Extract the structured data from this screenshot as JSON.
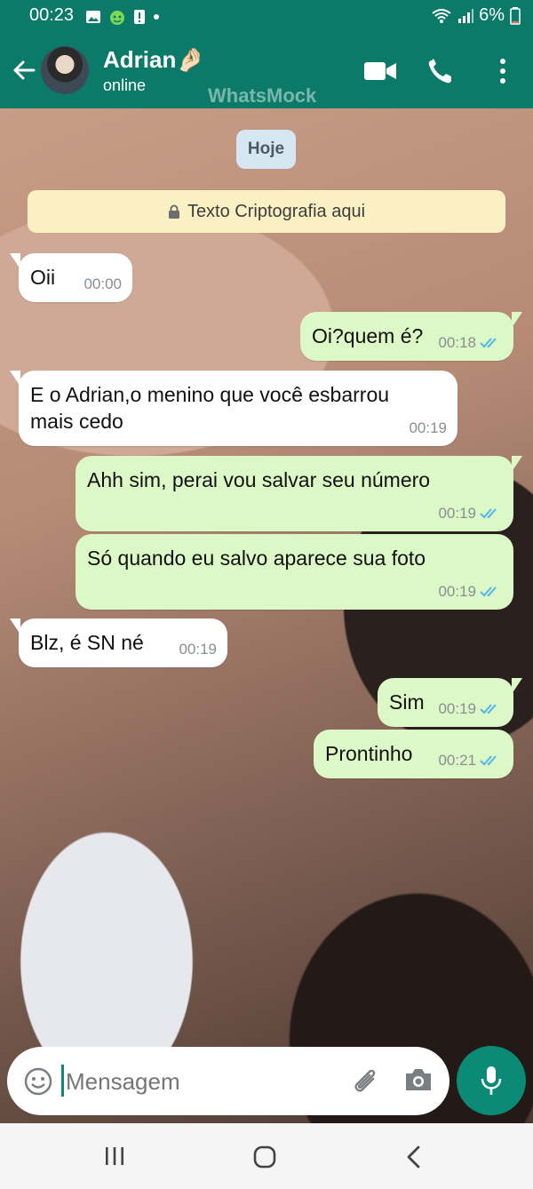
{
  "status_bar": {
    "time": "00:23",
    "battery": "6%"
  },
  "contact": {
    "name": "Adrian",
    "emoji": "🤌🏻",
    "status": "online"
  },
  "watermark": "WhatsMock",
  "chat": {
    "day_badge": "Hoje",
    "encryption_notice": "Texto Criptografia aqui",
    "messages": [
      {
        "direction": "in",
        "lines": [
          "Oii"
        ],
        "time": "00:00"
      },
      {
        "direction": "out",
        "lines": [
          "Oi?quem é?"
        ],
        "time": "00:18",
        "read": true
      },
      {
        "direction": "in",
        "lines": [
          "E o Adrian,o menino que você esbarrou",
          "mais cedo"
        ],
        "time": "00:19"
      },
      {
        "direction": "out",
        "lines": [
          "Ahh sim, perai vou salvar seu número"
        ],
        "time": "00:19",
        "read": true
      },
      {
        "direction": "out",
        "lines": [
          "Só quando eu salvo aparece sua foto"
        ],
        "time": "00:19",
        "read": true
      },
      {
        "direction": "in",
        "lines": [
          "Blz, é SN né"
        ],
        "time": "00:19"
      },
      {
        "direction": "out",
        "lines": [
          "Sim"
        ],
        "time": "00:19",
        "read": true
      },
      {
        "direction": "out",
        "lines": [
          "Prontinho"
        ],
        "time": "00:21",
        "read": true
      }
    ]
  },
  "composer": {
    "placeholder": "Mensagem"
  },
  "colors": {
    "header": "#0b7a68",
    "outgoing_bubble": "#dcf8c6",
    "incoming_bubble": "#ffffff",
    "read_ticks": "#4fb6ec",
    "mic_button": "#0b8a77"
  }
}
